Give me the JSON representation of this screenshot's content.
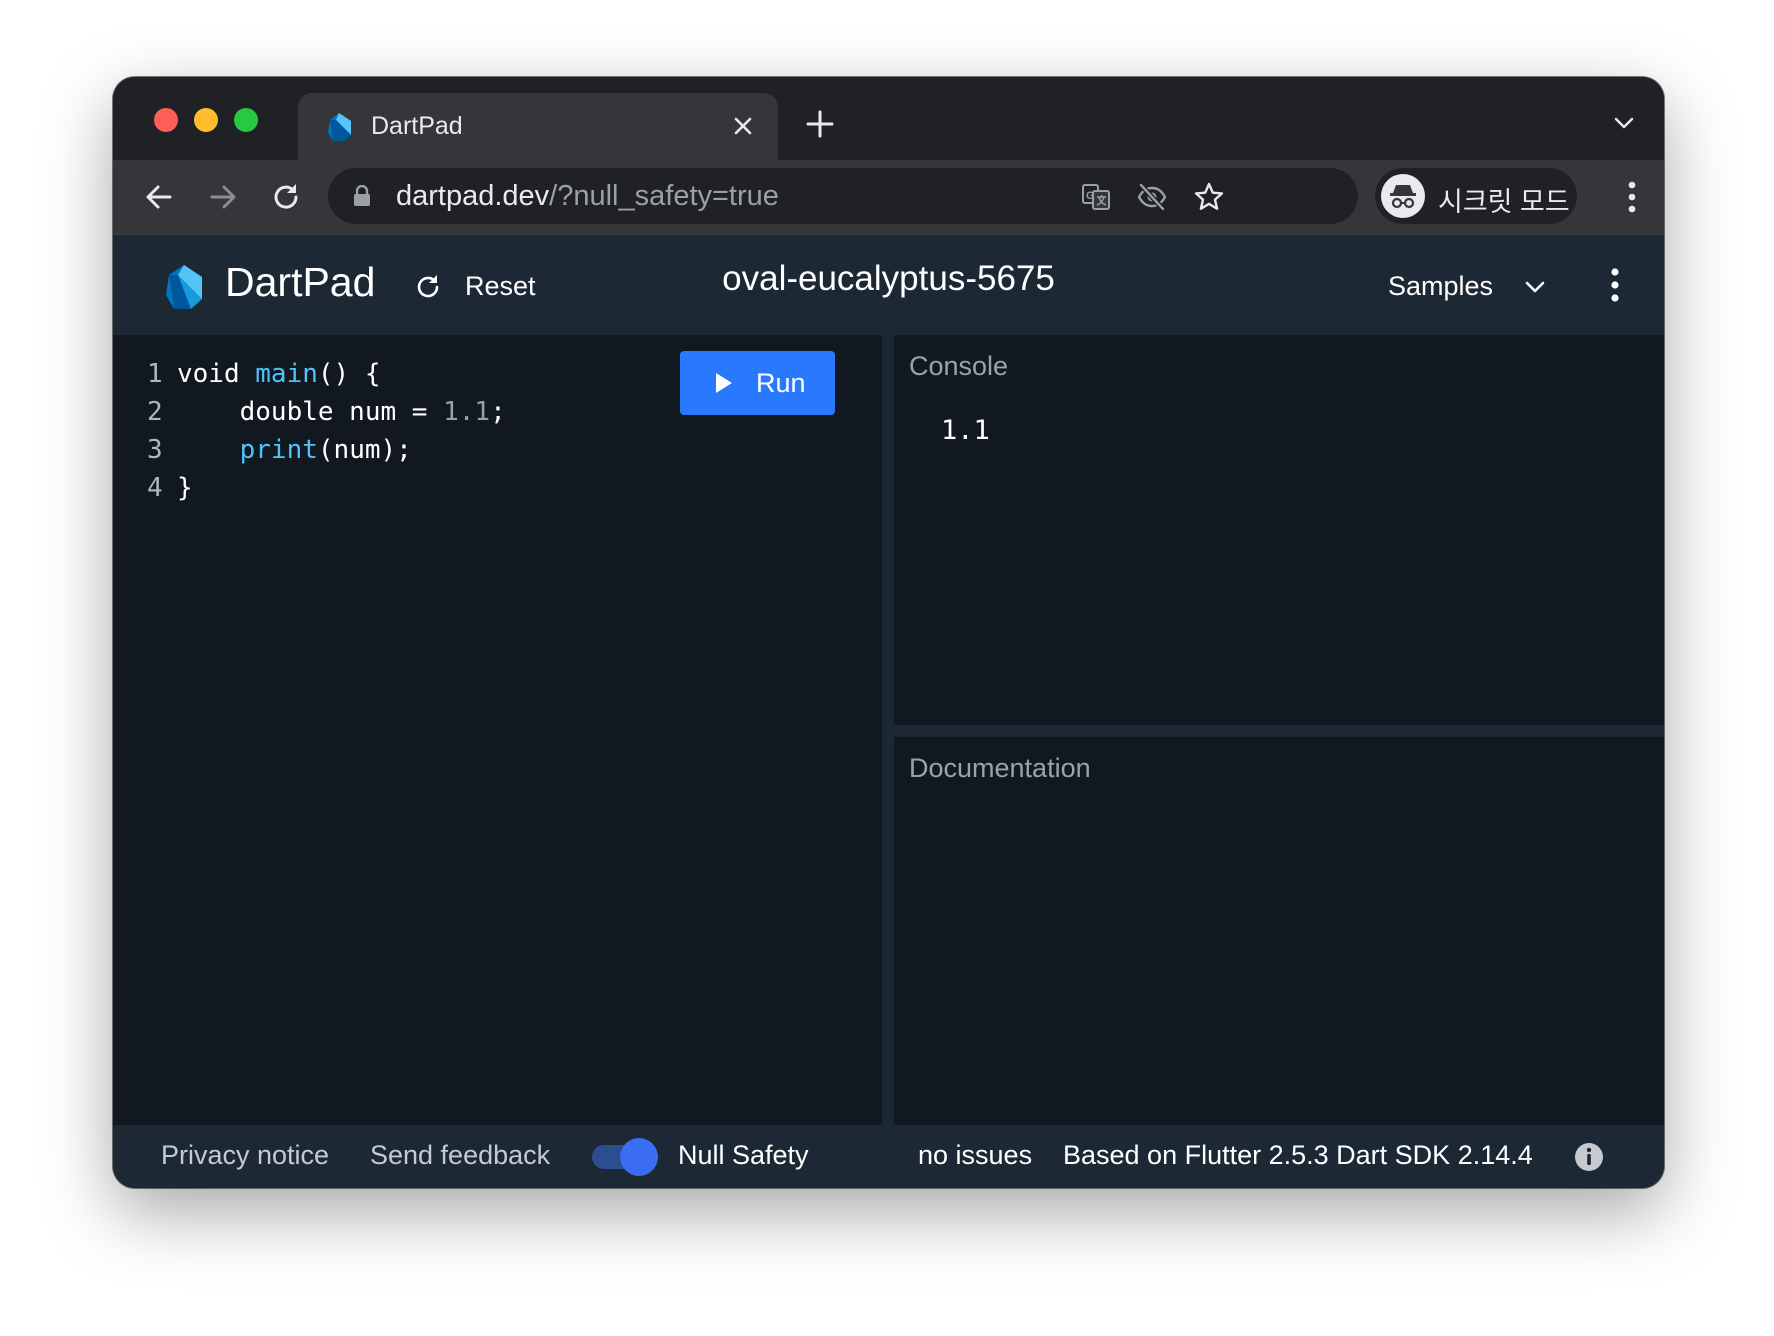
{
  "browser": {
    "tab": {
      "title": "DartPad"
    },
    "omnibox": {
      "host": "dartpad.dev",
      "path": "/?null_safety=true"
    },
    "profile": {
      "label": "시크릿 모드"
    }
  },
  "header": {
    "brand": "DartPad",
    "reset_label": "Reset",
    "pad_name": "oval-eucalyptus-5675",
    "samples_label": "Samples"
  },
  "editor": {
    "run_label": "Run",
    "lines": [
      {
        "n": "1",
        "tokens": [
          "void ",
          "main",
          "() {"
        ]
      },
      {
        "n": "2",
        "tokens": [
          "    double num = ",
          "1.1",
          ";"
        ]
      },
      {
        "n": "3",
        "tokens": [
          "    ",
          "print",
          "(num);"
        ]
      },
      {
        "n": "4",
        "tokens": [
          "}"
        ]
      }
    ]
  },
  "console": {
    "title": "Console",
    "output": "1.1"
  },
  "docs": {
    "title": "Documentation"
  },
  "footer": {
    "privacy": "Privacy notice",
    "feedback": "Send feedback",
    "null_safety": "Null Safety",
    "null_safety_on": true,
    "issues": "no issues",
    "version": "Based on Flutter 2.5.3 Dart SDK 2.14.4"
  },
  "colors": {
    "run_button": "#2979ff",
    "header_bg": "#1c2834",
    "editor_bg": "#121820",
    "function_token": "#4fc3f7"
  },
  "icons": [
    "dart-logo-icon",
    "close-icon",
    "plus-icon",
    "chevron-down-icon",
    "back-arrow-icon",
    "forward-arrow-icon",
    "reload-icon",
    "lock-icon",
    "translate-icon",
    "eye-off-icon",
    "star-icon",
    "incognito-icon",
    "more-vert-icon",
    "refresh-icon",
    "play-icon",
    "info-icon"
  ]
}
